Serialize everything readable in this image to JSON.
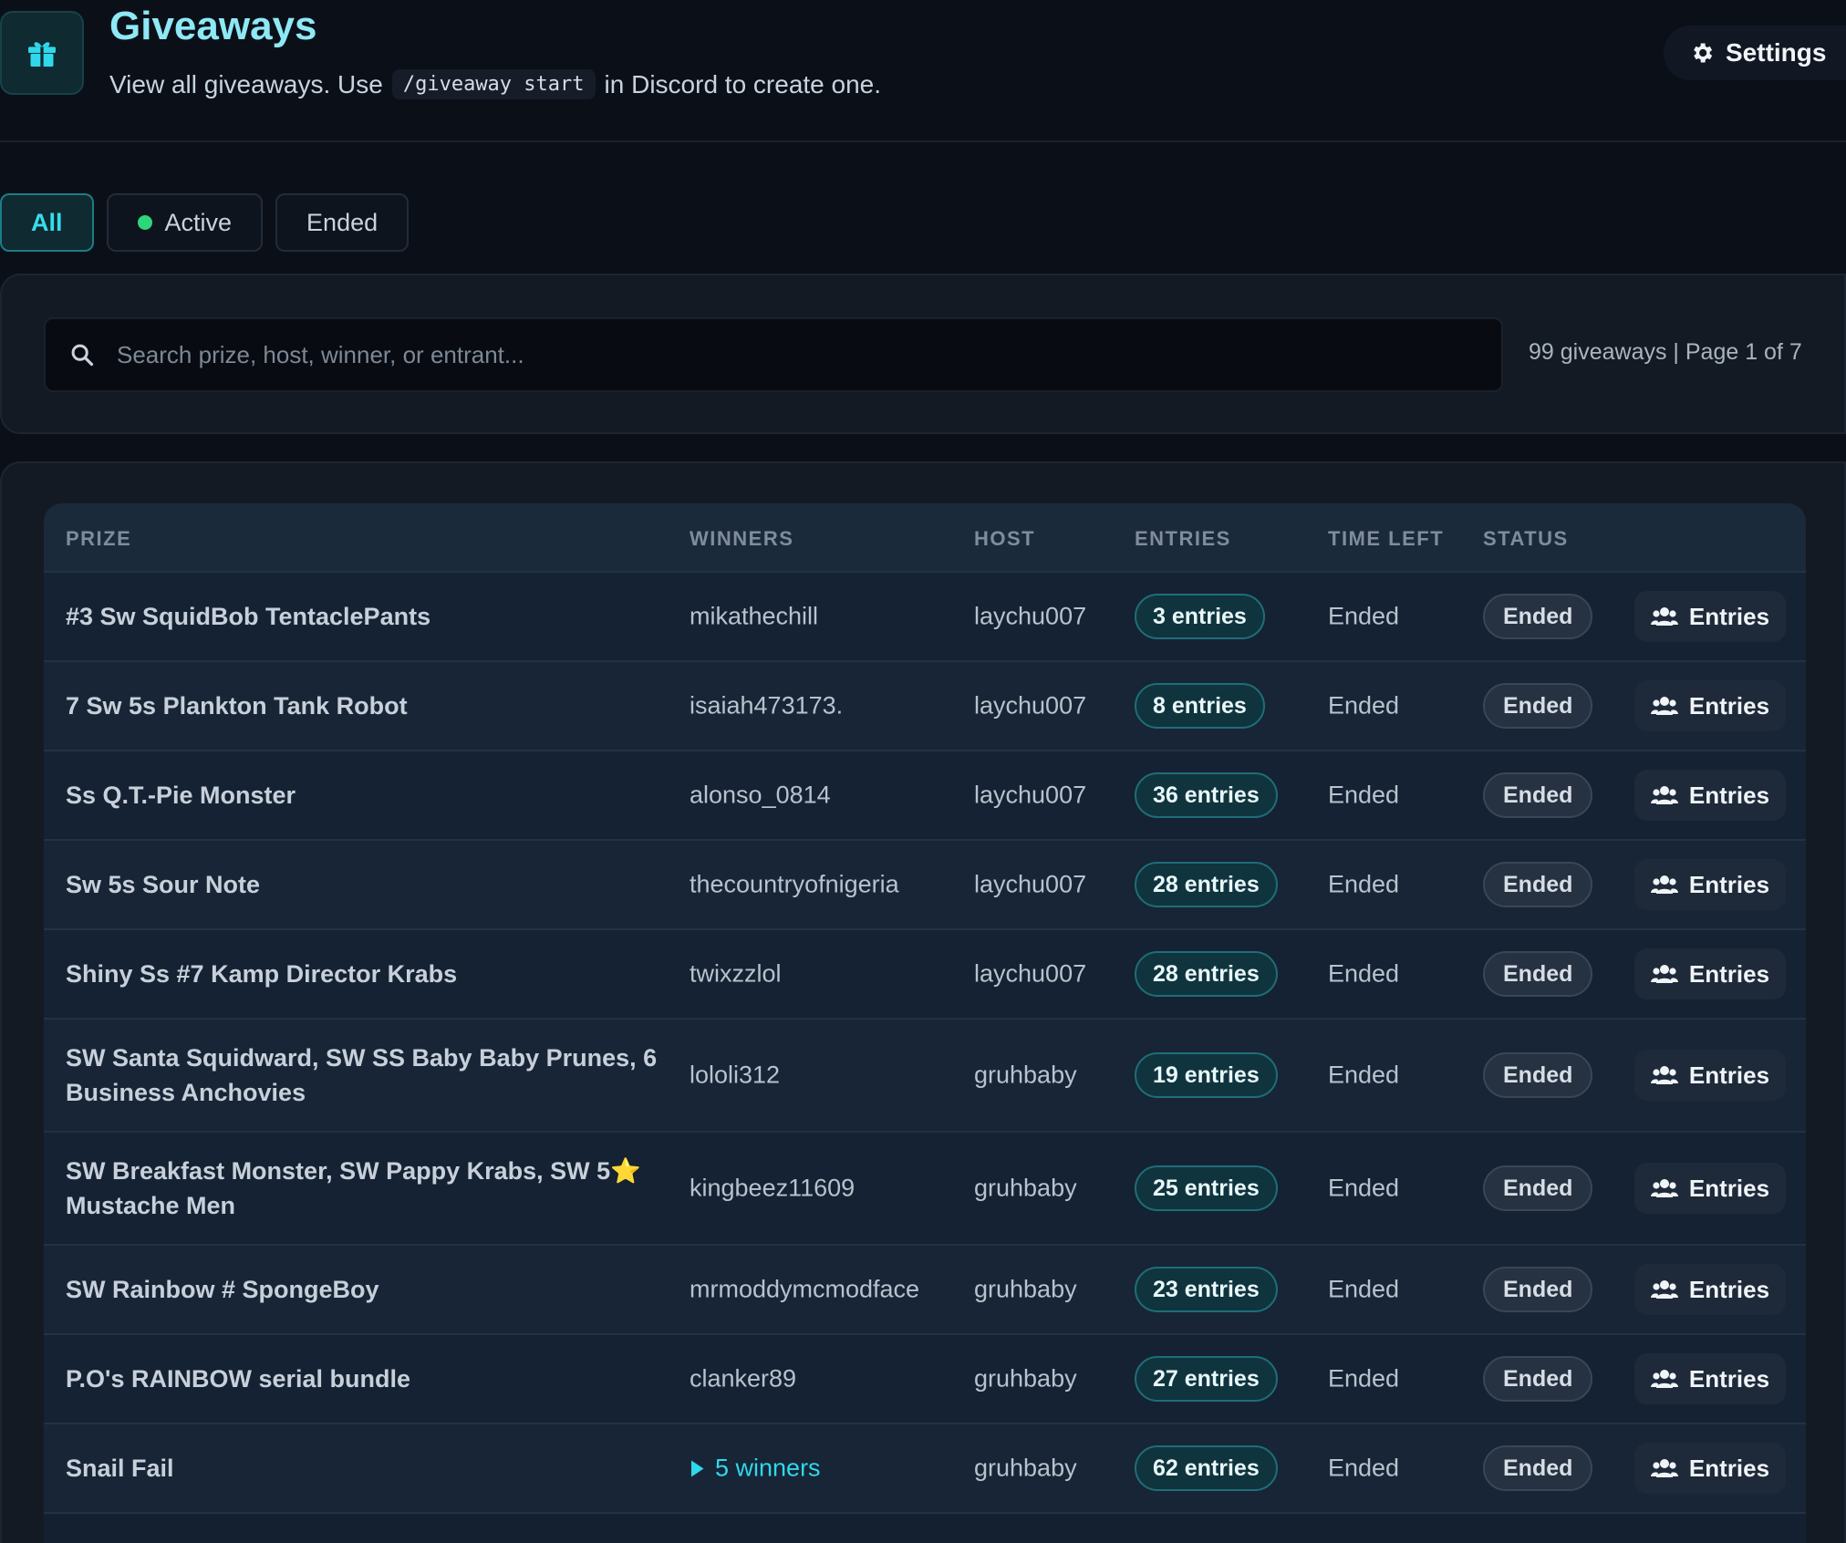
{
  "header": {
    "title": "Giveaways",
    "subtitle_before": "View all giveaways. Use",
    "command": "/giveaway start",
    "subtitle_after": "in Discord to create one.",
    "settings_label": "Settings"
  },
  "tabs": [
    {
      "label": "All",
      "active": true
    },
    {
      "label": "Active",
      "active": false
    },
    {
      "label": "Ended",
      "active": false
    }
  ],
  "search": {
    "placeholder": "Search prize, host, winner, or entrant...",
    "value": "",
    "count_text": "99 giveaways | Page 1 of 7"
  },
  "table": {
    "columns": [
      "PRIZE",
      "WINNERS",
      "HOST",
      "ENTRIES",
      "TIME LEFT",
      "STATUS"
    ],
    "action_label": "Entries",
    "rows": [
      {
        "prize": "#3 Sw SquidBob TentaclePants",
        "winner": "mikathechill",
        "host": "laychu007",
        "entries": "3 entries",
        "time_left": "Ended",
        "status": "Ended"
      },
      {
        "prize": "7 Sw 5s Plankton Tank Robot",
        "winner": "isaiah473173.",
        "host": "laychu007",
        "entries": "8 entries",
        "time_left": "Ended",
        "status": "Ended"
      },
      {
        "prize": "Ss Q.T.-Pie Monster",
        "winner": "alonso_0814",
        "host": "laychu007",
        "entries": "36 entries",
        "time_left": "Ended",
        "status": "Ended"
      },
      {
        "prize": "Sw 5s Sour Note",
        "winner": "thecountryofnigeria",
        "host": "laychu007",
        "entries": "28 entries",
        "time_left": "Ended",
        "status": "Ended"
      },
      {
        "prize": "Shiny Ss #7 Kamp Director Krabs",
        "winner": "twixzzlol",
        "host": "laychu007",
        "entries": "28 entries",
        "time_left": "Ended",
        "status": "Ended"
      },
      {
        "prize": "SW Santa Squidward, SW SS Baby Baby Prunes, 6 Business Anchovies",
        "winner": "lololi312",
        "host": "gruhbaby",
        "entries": "19 entries",
        "time_left": "Ended",
        "status": "Ended"
      },
      {
        "prize": "SW Breakfast Monster, SW Pappy Krabs, SW 5⭐ Mustache Men",
        "winner": "kingbeez11609",
        "host": "gruhbaby",
        "entries": "25 entries",
        "time_left": "Ended",
        "status": "Ended"
      },
      {
        "prize": "SW Rainbow # SpongeBoy",
        "winner": "mrmoddymcmodface",
        "host": "gruhbaby",
        "entries": "23 entries",
        "time_left": "Ended",
        "status": "Ended"
      },
      {
        "prize": "P.O's RAINBOW serial bundle",
        "winner": "clanker89",
        "host": "gruhbaby",
        "entries": "27 entries",
        "time_left": "Ended",
        "status": "Ended"
      },
      {
        "prize": "Snail Fail",
        "winner": "5 winners",
        "host": "gruhbaby",
        "entries": "62 entries",
        "time_left": "Ended",
        "status": "Ended"
      }
    ]
  }
}
